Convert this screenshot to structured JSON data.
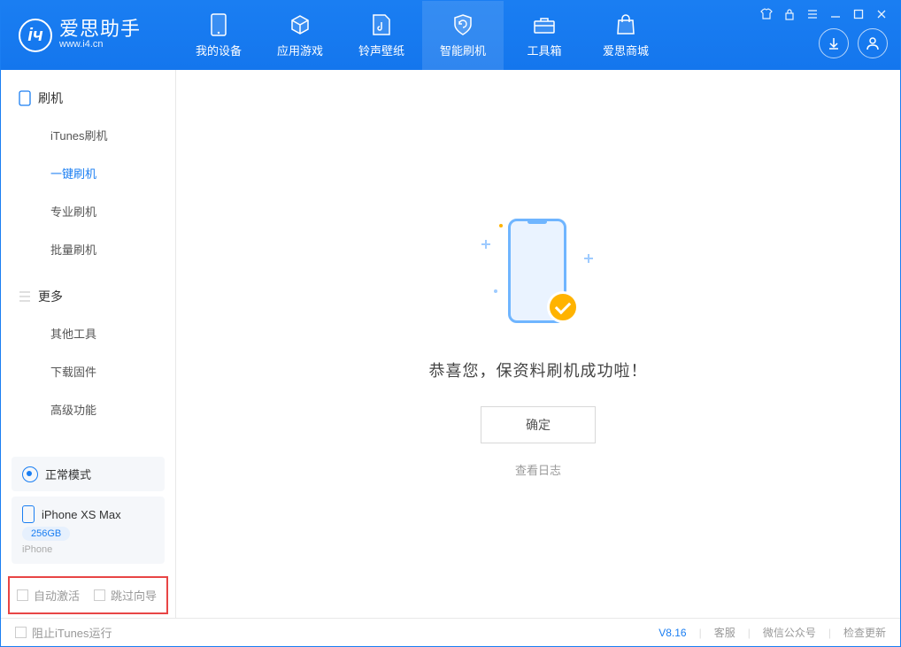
{
  "app": {
    "name": "爱思助手",
    "url": "www.i4.cn"
  },
  "tabs": {
    "device": "我的设备",
    "apps": "应用游戏",
    "ringtone": "铃声壁纸",
    "flash": "智能刷机",
    "toolbox": "工具箱",
    "store": "爱思商城"
  },
  "sidebar": {
    "section1_title": "刷机",
    "items1": {
      "itunes": "iTunes刷机",
      "onekey": "一键刷机",
      "pro": "专业刷机",
      "batch": "批量刷机"
    },
    "section2_title": "更多",
    "items2": {
      "other": "其他工具",
      "firmware": "下载固件",
      "advanced": "高级功能"
    }
  },
  "device_panel": {
    "mode": "正常模式",
    "name": "iPhone XS Max",
    "storage": "256GB",
    "type": "iPhone"
  },
  "options": {
    "auto_activate": "自动激活",
    "skip_guide": "跳过向导"
  },
  "main": {
    "success_text": "恭喜您，保资料刷机成功啦！",
    "confirm": "确定",
    "log_link": "查看日志"
  },
  "footer": {
    "block_itunes": "阻止iTunes运行",
    "version": "V8.16",
    "support": "客服",
    "wechat": "微信公众号",
    "update": "检查更新"
  }
}
